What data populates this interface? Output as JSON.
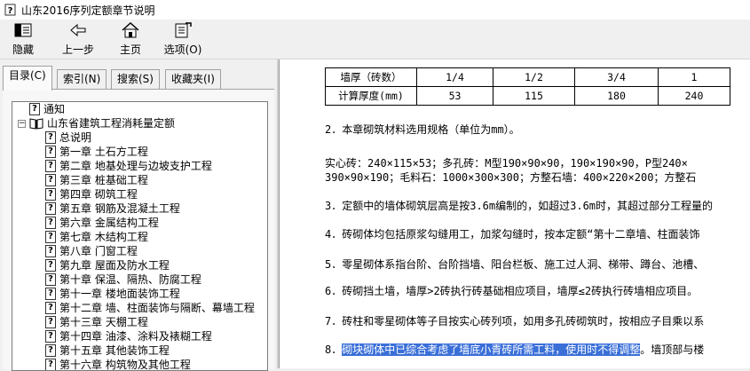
{
  "window": {
    "title": "山东2016序列定额章节说明"
  },
  "toolbar": {
    "hide": "隐藏",
    "back": "上一步",
    "home": "主页",
    "options": "选项(O)"
  },
  "tabs": [
    "目录(C)",
    "索引(N)",
    "搜索(S)",
    "收藏夹(I)"
  ],
  "tree": {
    "notice": "通知",
    "root": "山东省建筑工程消耗量定额",
    "items": [
      "总说明",
      "第一章 土石方工程",
      "第二章 地基处理与边坡支护工程",
      "第三章 桩基础工程",
      "第四章 砌筑工程",
      "第五章 钢筋及混凝土工程",
      "第六章 金属结构工程",
      "第七章 木结构工程",
      "第八章 门窗工程",
      "第九章 屋面及防水工程",
      "第十章 保温、隔热、防腐工程",
      "第十一章 楼地面装饰工程",
      "第十二章 墙、柱面装饰与隔断、幕墙工程",
      "第十三章 天棚工程",
      "第十四章 油漆、涂料及裱糊工程",
      "第十五章 其他装饰工程",
      "第十六章 构筑物及其他工程"
    ]
  },
  "content": {
    "table": {
      "row1": [
        "墙厚（砖数）",
        "1/4",
        "1/2",
        "3/4",
        "1"
      ],
      "row2": [
        "计算厚度(mm)",
        "53",
        "115",
        "180",
        "240"
      ]
    },
    "p2": "2．本章砌筑材料选用规格（单位为mm）。",
    "p_spec1": "实心砖：240×115×53；多孔砖：M型190×90×90，190×190×90，P型240×",
    "p_spec2": "390×90×190；毛料石：1000×300×300；方整石墙：400×220×200；方整石",
    "p3": "3．定额中的墙体砌筑层高是按3.6m编制的，如超过3.6m时，其超过部分工程量的",
    "p4": "4．砖砌体均包括原浆勾缝用工，加浆勾缝时，按本定额“第十二章墙、柱面装饰",
    "p5": "5．零星砌体系指台阶、台阶挡墙、阳台栏板、施工过人洞、梯带、蹲台、池槽、",
    "p6": "6．砖砌挡土墙，墙厚>2砖执行砖基础相应项目，墙厚≤2砖执行砖墙相应项目。",
    "p7": "7．砖柱和零星砌体等子目按实心砖列项，如用多孔砖砌筑时，按相应子目乘以系",
    "p8_num": "8．",
    "p8_highlight": "砌块砌体中已综合考虑了墙底小青砖所需工料，使用时不得调整",
    "p8_rest": "。墙顶部与楼"
  },
  "colors": {
    "highlight": "#3a6fd8"
  }
}
